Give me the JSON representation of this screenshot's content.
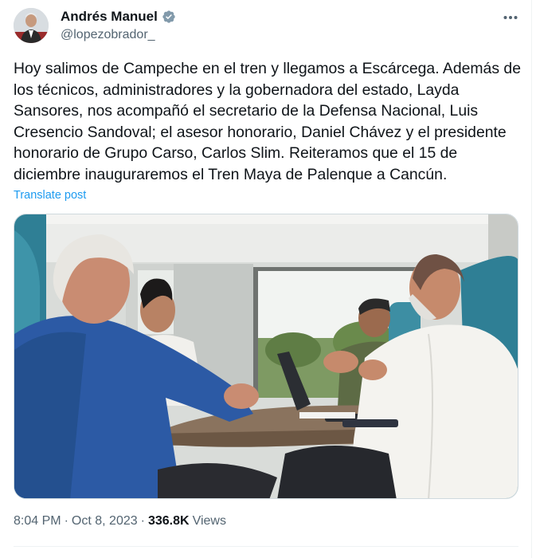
{
  "author": {
    "display_name": "Andrés Manuel",
    "handle": "@lopezobrador_",
    "verified_icon": "verified-badge-icon"
  },
  "tweet": {
    "text": "Hoy salimos de Campeche en el tren y llegamos a Escárcega. Además de\nlos técnicos, administradores y la gobernadora del estado, Layda\nSansores, nos acompañó el secretario de la Defensa Nacional, Luis\nCresencio Sandoval; el asesor honorario, Daniel Chávez y el presidente\nhonorario de Grupo Carso, Carlos Slim. Reiteramos que el 15 de\ndiciembre inauguraremos el Tren Maya de Palenque a Cancún.",
    "translate_label": "Translate post"
  },
  "meta": {
    "time": "8:04 PM",
    "separator": "·",
    "date": "Oct 8, 2023",
    "views_count": "336.8K",
    "views_label": "Views"
  },
  "colors": {
    "link": "#1d9bf0",
    "secondary_text": "#536471",
    "primary_text": "#0f1419",
    "verified": "#829aab"
  }
}
